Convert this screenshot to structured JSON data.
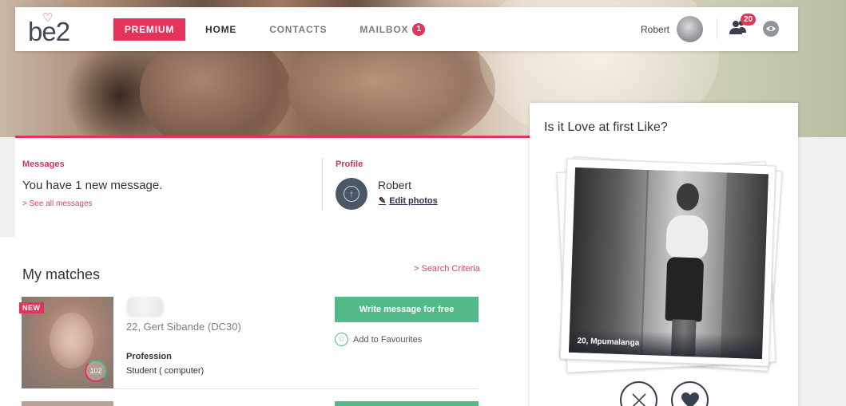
{
  "nav": {
    "logo": "be2",
    "premium": "PREMIUM",
    "home": "HOME",
    "contacts": "CONTACTS",
    "mailbox": "MAILBOX",
    "mailbox_count": "1",
    "user_name": "Robert",
    "contacts_count": "20"
  },
  "messages": {
    "label": "Messages",
    "text": "You have 1 new message.",
    "see_all": "> See all messages"
  },
  "profile": {
    "label": "Profile",
    "name": "Robert",
    "edit": "Edit photos"
  },
  "matches": {
    "title": "My matches",
    "search_criteria": "> Search Criteria",
    "items": [
      {
        "badge": "NEW",
        "score": "102",
        "location": "22, Gert Sibande (DC30)",
        "profession_label": "Profession",
        "profession": "Student ( computer)",
        "write_button": "Write message for free",
        "favourite": "Add to Favourites"
      }
    ]
  },
  "like": {
    "title": "Is it Love at first Like?",
    "caption": "20, Mpumalanga"
  },
  "colors": {
    "accent": "#e4345c",
    "green": "#52b988",
    "dark": "#3a4050"
  },
  "icons": [
    "heart-logo-icon",
    "contacts-icon",
    "eye-icon",
    "camera-upload-icon",
    "pencil-icon",
    "star-icon",
    "close-icon",
    "heart-icon"
  ]
}
